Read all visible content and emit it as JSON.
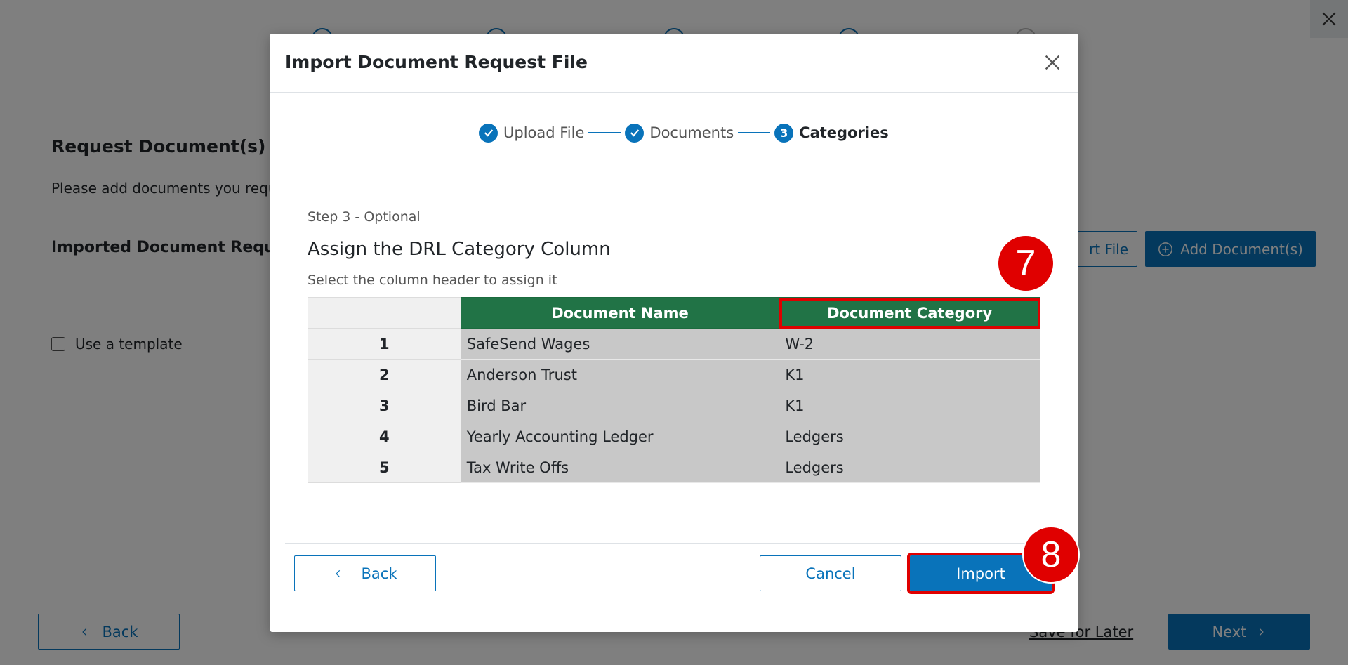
{
  "background": {
    "section_title": "Request Document(s) (0",
    "description": "Please add documents you requ",
    "imported_heading": "Imported Document Reque",
    "import_file_label": "rt File",
    "add_documents_label": "Add Document(s)",
    "use_template_label": "Use a template",
    "back_label": "Back",
    "save_later_label": "Save for Later",
    "next_label": "Next"
  },
  "modal": {
    "title": "Import Document Request File",
    "steps": [
      {
        "label": "Upload File",
        "status": "complete"
      },
      {
        "label": "Documents",
        "status": "complete"
      },
      {
        "label": "Categories",
        "status": "active",
        "number": "3"
      }
    ],
    "step_subtitle": "Step 3 - Optional",
    "assign_title": "Assign the DRL Category Column",
    "assign_description": "Select the column header to assign it",
    "table": {
      "headers": [
        "Document Name",
        "Document Category"
      ],
      "rows": [
        {
          "index": "1",
          "name": "SafeSend Wages",
          "category": "W-2"
        },
        {
          "index": "2",
          "name": "Anderson Trust",
          "category": "K1"
        },
        {
          "index": "3",
          "name": "Bird Bar",
          "category": "K1"
        },
        {
          "index": "4",
          "name": "Yearly Accounting Ledger",
          "category": "Ledgers"
        },
        {
          "index": "5",
          "name": "Tax Write Offs",
          "category": "Ledgers"
        }
      ]
    },
    "back_label": "Back",
    "cancel_label": "Cancel",
    "import_label": "Import"
  },
  "annotations": {
    "badge_category": "7",
    "badge_import": "8"
  },
  "colors": {
    "primary": "#0973ba",
    "header_green": "#217346",
    "highlight_red": "#e00000"
  }
}
